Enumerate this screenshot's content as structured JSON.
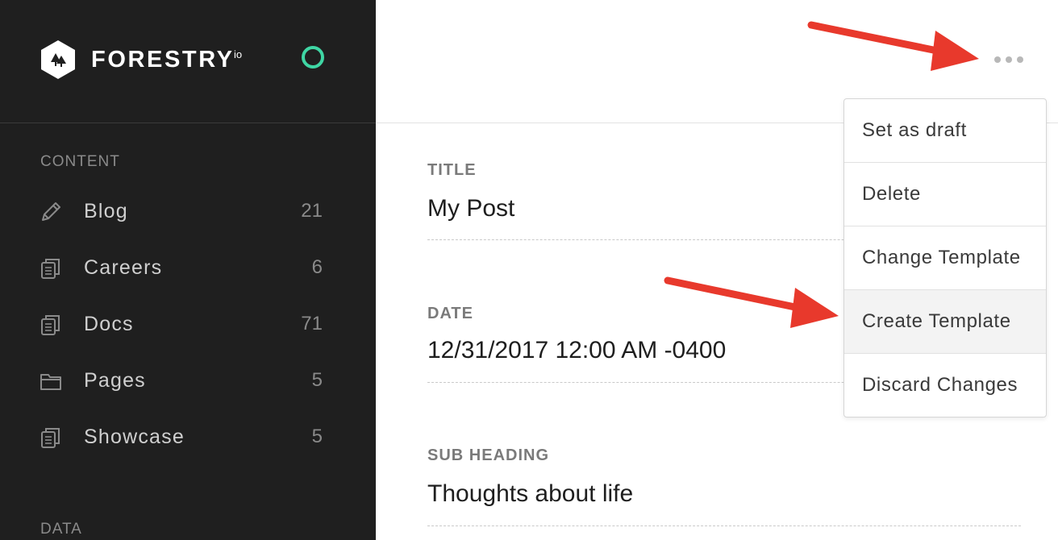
{
  "brand": {
    "name": "FORESTRY",
    "sup": "io",
    "status_color": "#3fd6a4"
  },
  "sidebar": {
    "content_label": "CONTENT",
    "data_label": "DATA",
    "items": [
      {
        "label": "Blog",
        "count": "21",
        "icon": "pencil-icon"
      },
      {
        "label": "Careers",
        "count": "6",
        "icon": "documents-icon"
      },
      {
        "label": "Docs",
        "count": "71",
        "icon": "documents-icon"
      },
      {
        "label": "Pages",
        "count": "5",
        "icon": "folder-icon"
      },
      {
        "label": "Showcase",
        "count": "5",
        "icon": "documents-icon"
      }
    ]
  },
  "editor": {
    "fields": [
      {
        "label": "TITLE",
        "value": "My Post"
      },
      {
        "label": "DATE",
        "value": "12/31/2017 12:00 AM -0400"
      },
      {
        "label": "SUB HEADING",
        "value": "Thoughts about life"
      }
    ]
  },
  "menu": {
    "items": [
      {
        "label": "Set as draft"
      },
      {
        "label": "Delete"
      },
      {
        "label": "Change Template"
      },
      {
        "label": "Create Template"
      },
      {
        "label": "Discard Changes"
      }
    ]
  },
  "colors": {
    "sidebar_bg": "#1f1f1f",
    "annotation_arrow": "#e8392c"
  }
}
